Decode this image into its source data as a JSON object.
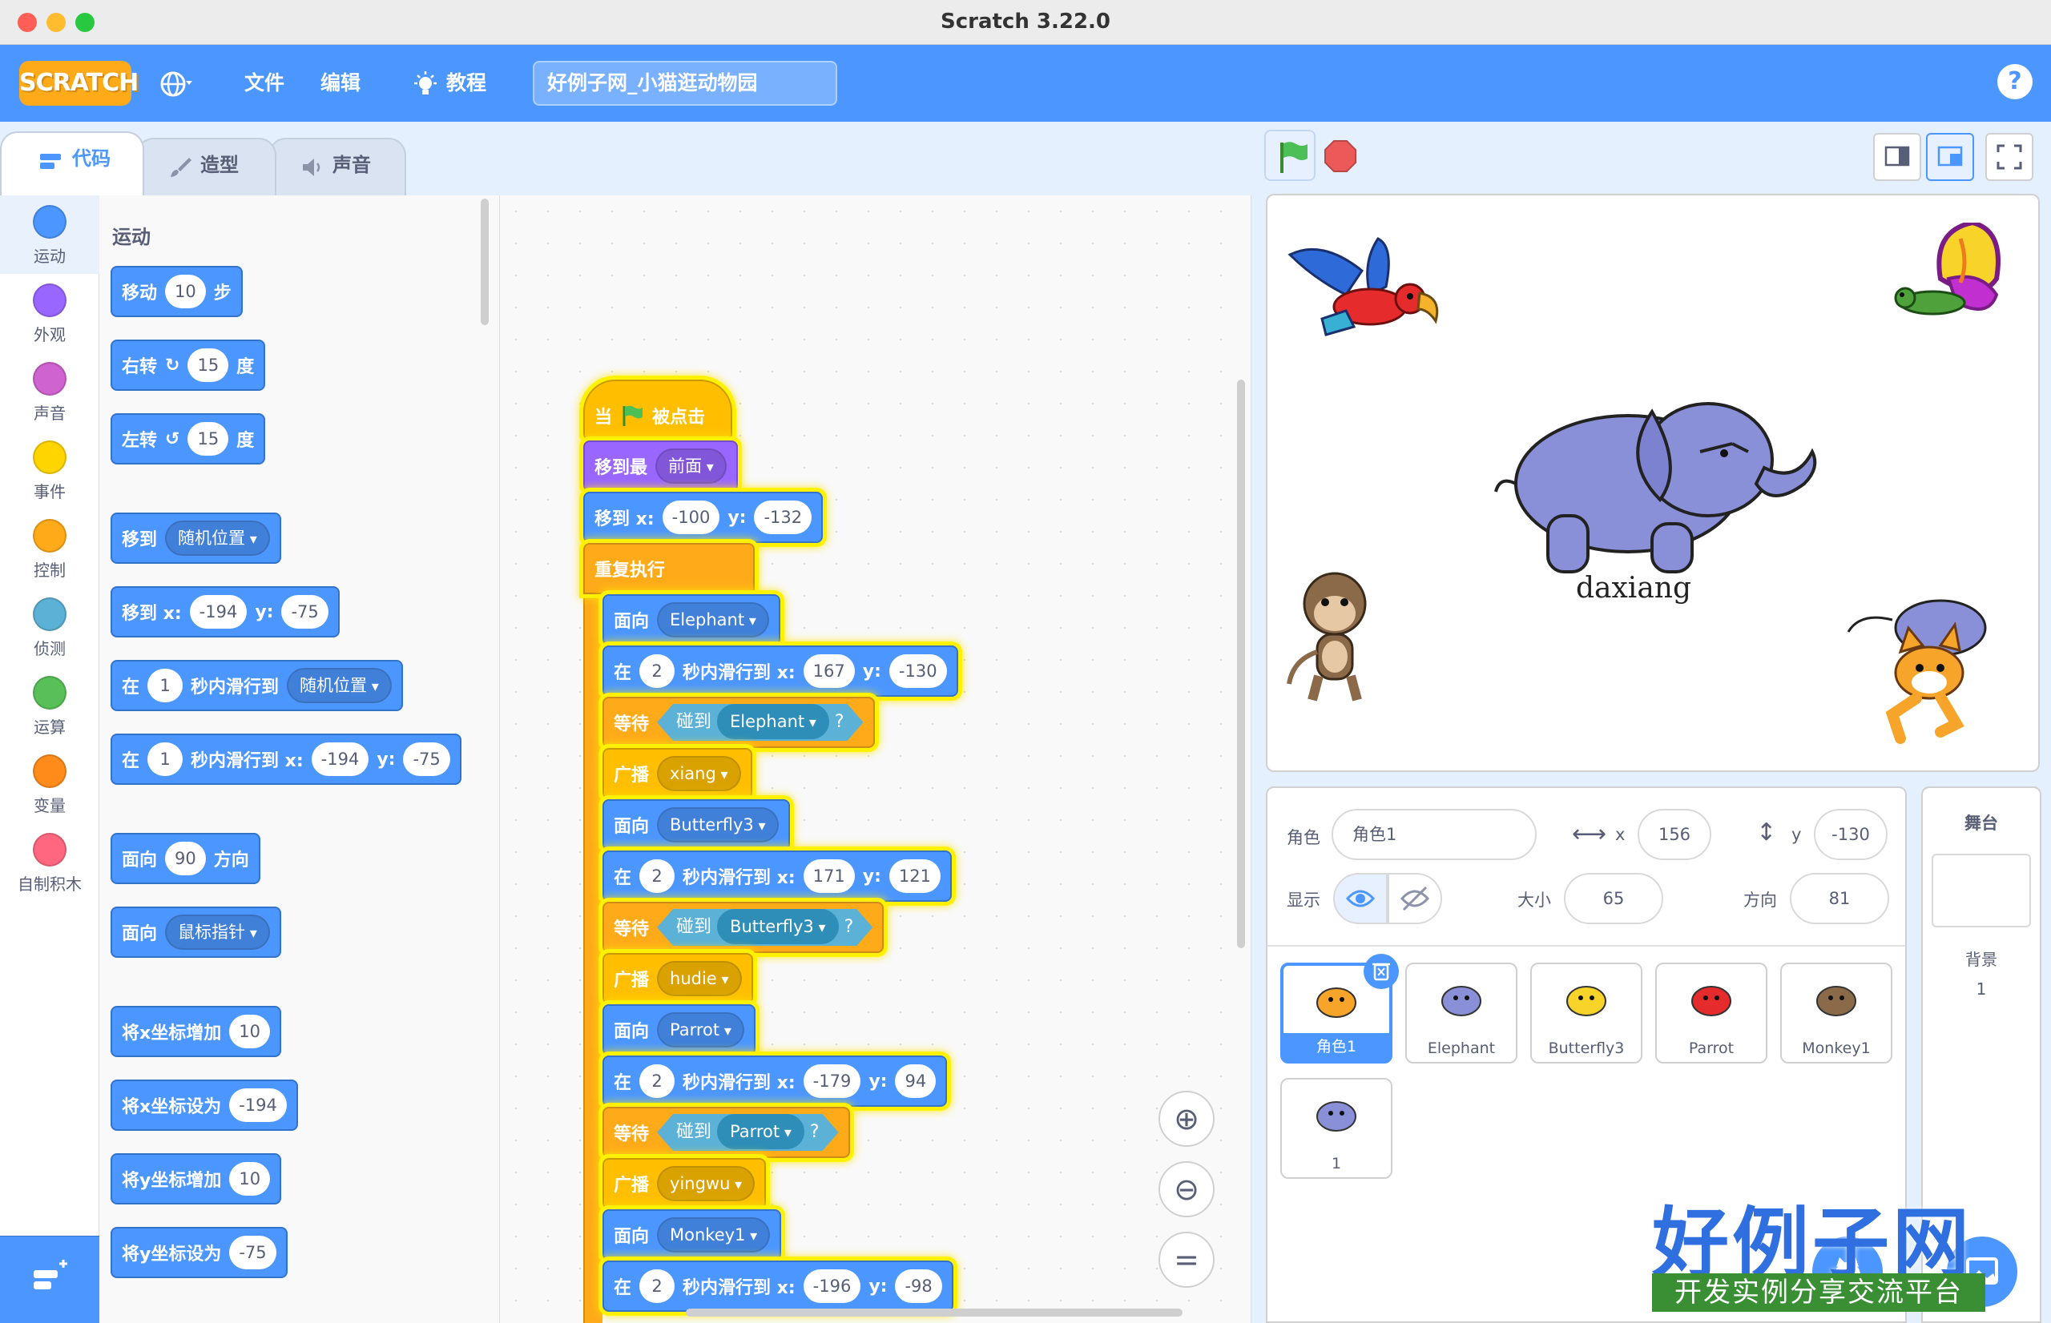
{
  "window": {
    "title": "Scratch 3.22.0"
  },
  "menubar": {
    "logo": "SCRATCH",
    "file": "文件",
    "edit": "编辑",
    "tutorials": "教程",
    "project_name": "好例子网_小猫逛动物园",
    "help": "?"
  },
  "tabs": {
    "code": "代码",
    "costumes": "造型",
    "sounds": "声音"
  },
  "categories": [
    {
      "label": "运动",
      "color": "#4c97ff"
    },
    {
      "label": "外观",
      "color": "#9966ff"
    },
    {
      "label": "声音",
      "color": "#cf63cf"
    },
    {
      "label": "事件",
      "color": "#ffd500"
    },
    {
      "label": "控制",
      "color": "#ffab19"
    },
    {
      "label": "侦测",
      "color": "#5cb1d6"
    },
    {
      "label": "运算",
      "color": "#59c059"
    },
    {
      "label": "变量",
      "color": "#ff8c1a"
    },
    {
      "label": "自制积木",
      "color": "#ff6680"
    }
  ],
  "flyout": {
    "title": "运动",
    "blocks": {
      "move": {
        "a": "移动",
        "v": "10",
        "b": "步"
      },
      "turn_right": {
        "a": "右转",
        "v": "15",
        "b": "度"
      },
      "turn_left": {
        "a": "左转",
        "v": "15",
        "b": "度"
      },
      "goto": {
        "a": "移到",
        "dd": "随机位置"
      },
      "goto_xy": {
        "a": "移到 x:",
        "x": "-194",
        "b": "y:",
        "y": "-75"
      },
      "glide": {
        "a": "在",
        "v": "1",
        "b": "秒内滑行到",
        "dd": "随机位置"
      },
      "glide_xy": {
        "a": "在",
        "v": "1",
        "b": "秒内滑行到 x:",
        "x": "-194",
        "c": "y:",
        "y": "-75"
      },
      "point_dir": {
        "a": "面向",
        "v": "90",
        "b": "方向"
      },
      "point_towards": {
        "a": "面向",
        "dd": "鼠标指针"
      },
      "change_x": {
        "a": "将x坐标增加",
        "v": "10"
      },
      "set_x": {
        "a": "将x坐标设为",
        "v": "-194"
      },
      "change_y": {
        "a": "将y坐标增加",
        "v": "10"
      },
      "set_y": {
        "a": "将y坐标设为",
        "v": "-75"
      }
    }
  },
  "script": {
    "hat": {
      "a": "当",
      "b": "被点击"
    },
    "front": {
      "a": "移到最",
      "dd": "前面"
    },
    "goto": {
      "a": "移到 x:",
      "x": "-100",
      "b": "y:",
      "y": "-132"
    },
    "forever": "重复执行",
    "steps": [
      {
        "face": "Elephant",
        "glide_s": "2",
        "x": "167",
        "y": "-130",
        "touch": "Elephant",
        "broadcast": "xiang"
      },
      {
        "face": "Butterfly3",
        "glide_s": "2",
        "x": "171",
        "y": "121",
        "touch": "Butterfly3",
        "broadcast": "hudie"
      },
      {
        "face": "Parrot",
        "glide_s": "2",
        "x": "-179",
        "y": "94",
        "touch": "Parrot",
        "broadcast": "yingwu"
      },
      {
        "face": "Monkey1",
        "glide_s": "2",
        "x": "-196",
        "y": "-98"
      }
    ],
    "labels": {
      "face": "面向",
      "in": "在",
      "glide_to": "秒内滑行到 x:",
      "y": "y:",
      "wait": "等待",
      "touching": "碰到",
      "q": "?",
      "broadcast": "广播"
    }
  },
  "stage": {
    "sprite_label": "daxiang"
  },
  "sprite_info": {
    "sprite_label": "角色",
    "sprite_name": "角色1",
    "x_label": "x",
    "x": "156",
    "y_label": "y",
    "y": "-130",
    "show_label": "显示",
    "size_label": "大小",
    "size": "65",
    "direction_label": "方向",
    "direction": "81"
  },
  "sprites": [
    {
      "name": "角色1",
      "selected": true
    },
    {
      "name": "Elephant"
    },
    {
      "name": "Butterfly3"
    },
    {
      "name": "Parrot"
    },
    {
      "name": "Monkey1"
    },
    {
      "name": "1"
    }
  ],
  "stage_target": {
    "title": "舞台",
    "backdrops_label": "背景",
    "backdrops_count": "1"
  },
  "watermark": {
    "brand": "好例子网",
    "sub": "开发实例分享交流平台"
  }
}
